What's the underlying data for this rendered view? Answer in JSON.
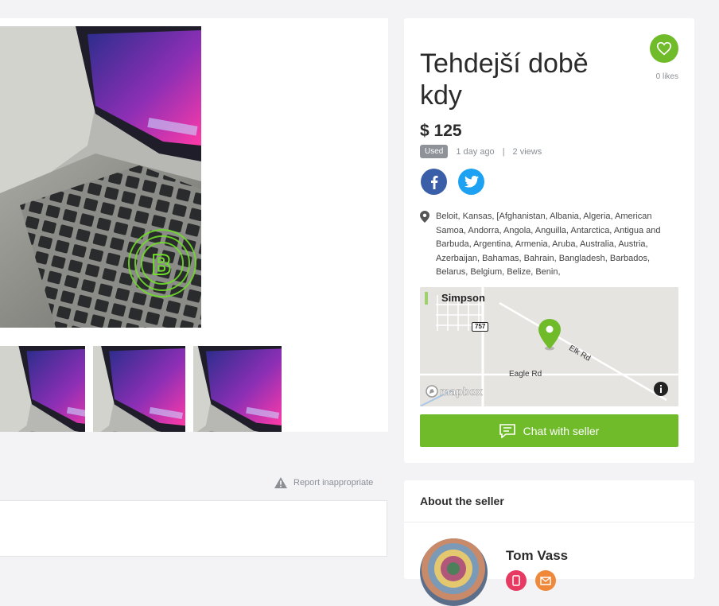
{
  "listing": {
    "title": "Tehdejší době kdy",
    "likes_text": "0 likes",
    "price": "$ 125",
    "condition": "Used",
    "posted": "1 day ago",
    "separator": "|",
    "views": "2 views",
    "location": "Beloit, Kansas, [Afghanistan, Albania, Algeria, American Samoa, Andorra, Angola, Anguilla, Antarctica, Antigua and Barbuda, Argentina, Armenia, Aruba, Australia, Austria, Azerbaijan, Bahamas, Bahrain, Bangladesh, Barbados, Belarus, Belgium, Belize, Benin,"
  },
  "map": {
    "town": "Simpson",
    "road_shield": "757",
    "road_1": "Elk Rd",
    "road_2": "Eagle Rd",
    "brand": "mapbox"
  },
  "actions": {
    "chat_label": "Chat with seller",
    "report_label": "Report inappropriate"
  },
  "seller": {
    "section_title": "About the seller",
    "name": "Tom Vass"
  },
  "colors": {
    "accent": "#6fbb2a",
    "facebook": "#3b5ea8",
    "twitter": "#1da1f2"
  }
}
